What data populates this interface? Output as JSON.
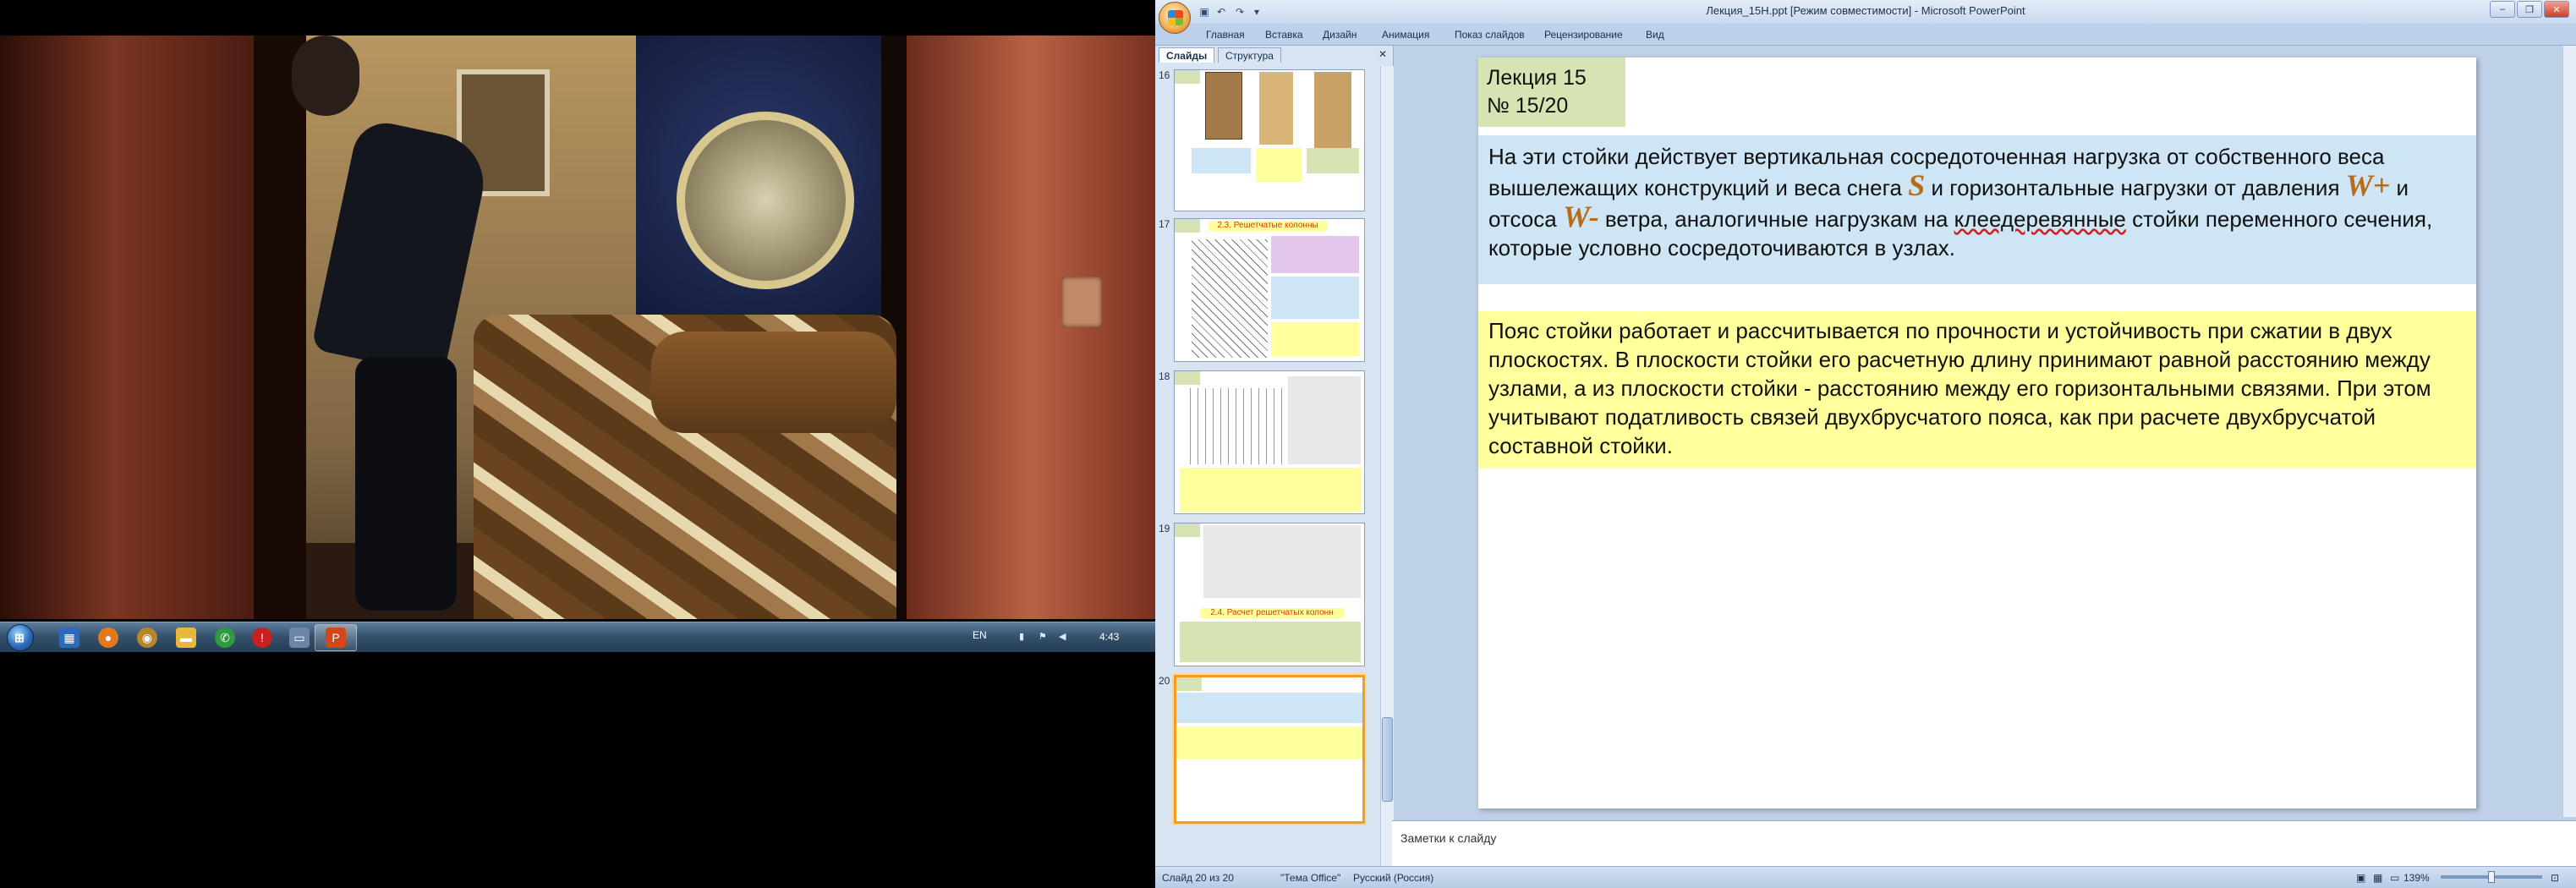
{
  "taskbar": {
    "start_label": "⊞",
    "language": "EN",
    "clock": "4:43",
    "icons": [
      "explorer-icon",
      "firefox-icon",
      "media-icon",
      "folder-icon",
      "chat-icon",
      "antivirus-icon",
      "window-icon",
      "powerpoint-icon"
    ]
  },
  "ppt": {
    "window_title": "Лекция_15Н.ppt [Режим совместимости] - Microsoft PowerPoint",
    "ribbon_tabs": [
      "Главная",
      "Вставка",
      "Дизайн",
      "Анимация",
      "Показ слайдов",
      "Рецензирование",
      "Вид"
    ],
    "panel_tabs": [
      "Слайды",
      "Структура"
    ],
    "thumbnails": [
      {
        "num": "16",
        "caption": ""
      },
      {
        "num": "17",
        "caption": "2.3. Решетчатые колонны"
      },
      {
        "num": "18",
        "caption": ""
      },
      {
        "num": "19",
        "caption": "2.4. Расчет решетчатых колонн"
      },
      {
        "num": "20",
        "caption": ""
      }
    ],
    "slide": {
      "lecture_title": "Лекция 15",
      "lecture_number": "№ 15/20",
      "para1_a": "На эти стойки действует вертикальная сосредоточенная нагрузка от собственного веса вышележащих конструкций и веса снега ",
      "sym_s": "S",
      "para1_b": " и горизонтальные нагрузки от давления ",
      "sym_wplus": "W+",
      "para1_c": "  и отсоса ",
      "sym_wminus": "W-",
      "para1_d": " ветра, аналогичные нагрузкам на ",
      "para1_e": "клеедеревянные",
      "para1_f": " стойки переменного сечения, которые условно сосредоточиваются в узлах.",
      "para2": "Пояс стойки работает и рассчитывается по прочности и устойчивость при сжатии в двух плоскостях. В плоскости стойки его расчетную длину принимают равной расстоянию между узлами, а из плоскости стойки - расстоянию между его горизонтальными связями. При этом учитывают податливость связей двухбрусчатого пояса, как при расчете двухбрусчатой составной стойки."
    },
    "notes_placeholder": "Заметки к слайду",
    "status": {
      "slide_counter": "Слайд 20 из 20",
      "theme": "\"Тема Office\"",
      "language": "Русский (Россия)",
      "zoom": "139%"
    }
  }
}
